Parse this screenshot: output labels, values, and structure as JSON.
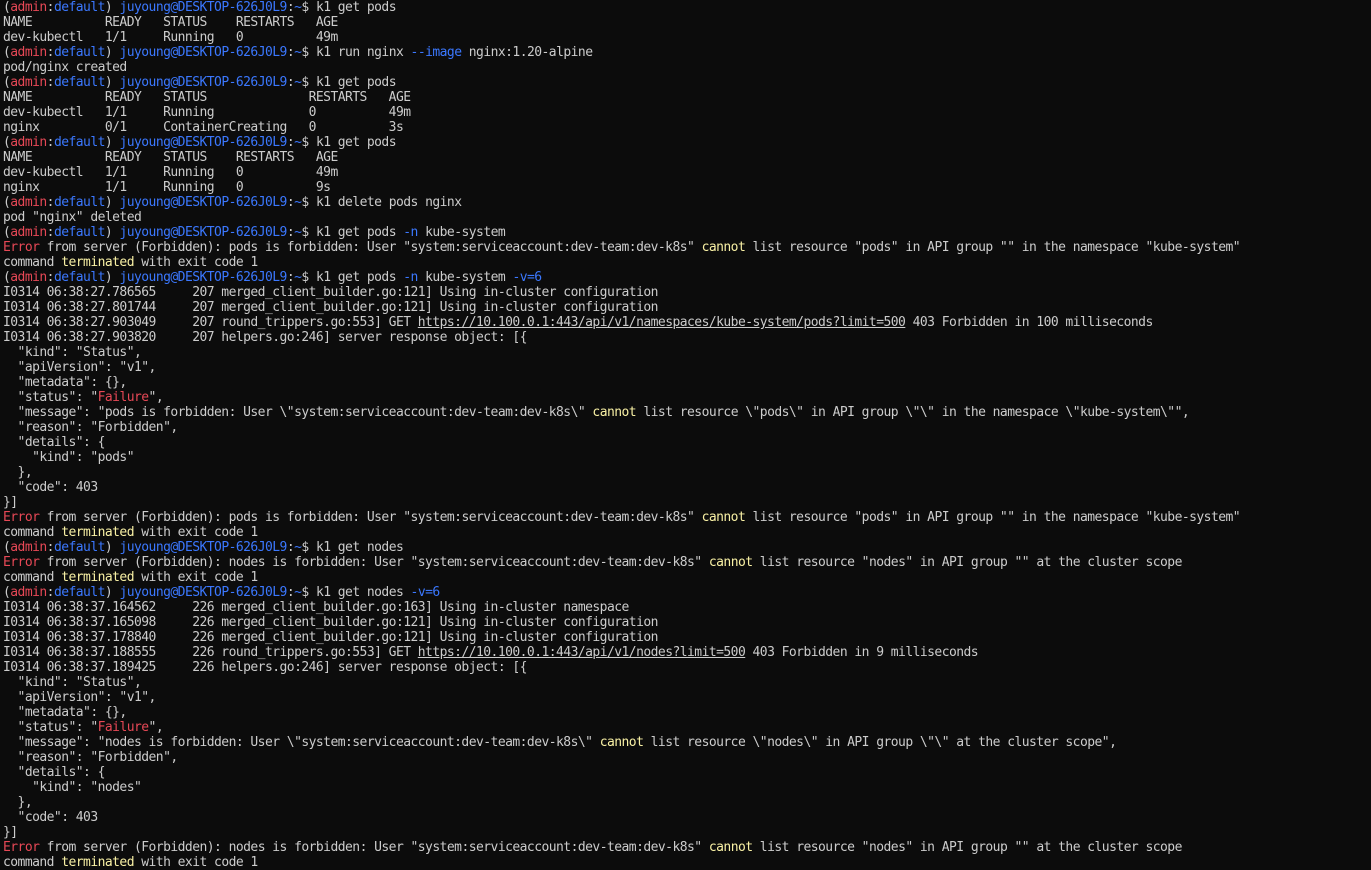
{
  "window": {
    "kind": "terminal",
    "background": "#0c0c0c",
    "colors": {
      "default": "#cccccc",
      "red": "#e74856",
      "blue": "#3b78ff",
      "yellow": "#f9f1a5"
    }
  },
  "prompt": {
    "open": "(",
    "user": "admin",
    "sep": ":",
    "ns": "default",
    "close": ")",
    "host": " juyoung@DESKTOP-626J0L9",
    "colon": ":",
    "path": "~",
    "dollar": "$ "
  },
  "lines": [
    [
      {
        "t": "(",
        "c": "plain",
        "p": true
      },
      {
        "t": "admin",
        "c": "red"
      },
      {
        "t": ":",
        "c": "plain"
      },
      {
        "t": "default",
        "c": "blue"
      },
      {
        "t": ") ",
        "c": "plain"
      },
      {
        "t": "juyoung@DESKTOP-626J0L9",
        "c": "blue"
      },
      {
        "t": ":",
        "c": "plain"
      },
      {
        "t": "~",
        "c": "blue"
      },
      {
        "t": "$ k1 get pods",
        "c": "plain"
      }
    ],
    [
      {
        "t": "NAME          READY   STATUS    RESTARTS   AGE",
        "c": "plain"
      }
    ],
    [
      {
        "t": "dev-kubectl   1/1     Running   0          49m",
        "c": "plain"
      }
    ],
    [
      {
        "t": "(",
        "c": "plain",
        "p": true
      },
      {
        "t": "admin",
        "c": "red"
      },
      {
        "t": ":",
        "c": "plain"
      },
      {
        "t": "default",
        "c": "blue"
      },
      {
        "t": ") ",
        "c": "plain"
      },
      {
        "t": "juyoung@DESKTOP-626J0L9",
        "c": "blue"
      },
      {
        "t": ":",
        "c": "plain"
      },
      {
        "t": "~",
        "c": "blue"
      },
      {
        "t": "$ k1 run nginx ",
        "c": "plain"
      },
      {
        "t": "--image",
        "c": "blue"
      },
      {
        "t": " nginx:1.20-alpine",
        "c": "plain"
      }
    ],
    [
      {
        "t": "pod/nginx created",
        "c": "plain"
      }
    ],
    [
      {
        "t": "(",
        "c": "plain",
        "p": true
      },
      {
        "t": "admin",
        "c": "red"
      },
      {
        "t": ":",
        "c": "plain"
      },
      {
        "t": "default",
        "c": "blue"
      },
      {
        "t": ") ",
        "c": "plain"
      },
      {
        "t": "juyoung@DESKTOP-626J0L9",
        "c": "blue"
      },
      {
        "t": ":",
        "c": "plain"
      },
      {
        "t": "~",
        "c": "blue"
      },
      {
        "t": "$ k1 get pods",
        "c": "plain"
      }
    ],
    [
      {
        "t": "NAME          READY   STATUS              RESTARTS   AGE",
        "c": "plain"
      }
    ],
    [
      {
        "t": "dev-kubectl   1/1     Running             0          49m",
        "c": "plain"
      }
    ],
    [
      {
        "t": "nginx         0/1     ContainerCreating   0          3s",
        "c": "plain"
      }
    ],
    [
      {
        "t": "(",
        "c": "plain",
        "p": true
      },
      {
        "t": "admin",
        "c": "red"
      },
      {
        "t": ":",
        "c": "plain"
      },
      {
        "t": "default",
        "c": "blue"
      },
      {
        "t": ") ",
        "c": "plain"
      },
      {
        "t": "juyoung@DESKTOP-626J0L9",
        "c": "blue"
      },
      {
        "t": ":",
        "c": "plain"
      },
      {
        "t": "~",
        "c": "blue"
      },
      {
        "t": "$ k1 get pods",
        "c": "plain"
      }
    ],
    [
      {
        "t": "NAME          READY   STATUS    RESTARTS   AGE",
        "c": "plain"
      }
    ],
    [
      {
        "t": "dev-kubectl   1/1     Running   0          49m",
        "c": "plain"
      }
    ],
    [
      {
        "t": "nginx         1/1     Running   0          9s",
        "c": "plain"
      }
    ],
    [
      {
        "t": "(",
        "c": "plain",
        "p": true
      },
      {
        "t": "admin",
        "c": "red"
      },
      {
        "t": ":",
        "c": "plain"
      },
      {
        "t": "default",
        "c": "blue"
      },
      {
        "t": ") ",
        "c": "plain"
      },
      {
        "t": "juyoung@DESKTOP-626J0L9",
        "c": "blue"
      },
      {
        "t": ":",
        "c": "plain"
      },
      {
        "t": "~",
        "c": "blue"
      },
      {
        "t": "$ k1 delete pods nginx",
        "c": "plain"
      }
    ],
    [
      {
        "t": "pod \"nginx\" deleted",
        "c": "plain"
      }
    ],
    [
      {
        "t": "(",
        "c": "plain",
        "p": true
      },
      {
        "t": "admin",
        "c": "red"
      },
      {
        "t": ":",
        "c": "plain"
      },
      {
        "t": "default",
        "c": "blue"
      },
      {
        "t": ") ",
        "c": "plain"
      },
      {
        "t": "juyoung@DESKTOP-626J0L9",
        "c": "blue"
      },
      {
        "t": ":",
        "c": "plain"
      },
      {
        "t": "~",
        "c": "blue"
      },
      {
        "t": "$ k1 get pods ",
        "c": "plain"
      },
      {
        "t": "-n",
        "c": "blue"
      },
      {
        "t": " kube-system",
        "c": "plain"
      }
    ],
    [
      {
        "t": "Error",
        "c": "red"
      },
      {
        "t": " from server (Forbidden): pods is forbidden: User \"system:serviceaccount:dev-team:dev-k8s\" ",
        "c": "plain"
      },
      {
        "t": "cannot",
        "c": "yellow"
      },
      {
        "t": " list resource \"pods\" in API group \"\" in the namespace \"kube-system\"",
        "c": "plain"
      }
    ],
    [
      {
        "t": "command ",
        "c": "plain"
      },
      {
        "t": "terminated",
        "c": "yellow"
      },
      {
        "t": " with exit code 1",
        "c": "plain"
      }
    ],
    [
      {
        "t": "(",
        "c": "plain",
        "p": true
      },
      {
        "t": "admin",
        "c": "red"
      },
      {
        "t": ":",
        "c": "plain"
      },
      {
        "t": "default",
        "c": "blue"
      },
      {
        "t": ") ",
        "c": "plain"
      },
      {
        "t": "juyoung@DESKTOP-626J0L9",
        "c": "blue"
      },
      {
        "t": ":",
        "c": "plain"
      },
      {
        "t": "~",
        "c": "blue"
      },
      {
        "t": "$ k1 get pods ",
        "c": "plain"
      },
      {
        "t": "-n",
        "c": "blue"
      },
      {
        "t": " kube-system ",
        "c": "plain"
      },
      {
        "t": "-v=6",
        "c": "blue"
      }
    ],
    [
      {
        "t": "I0314 06:38:27.786565     207 merged_client_builder.go:121] Using in-cluster configuration",
        "c": "plain"
      }
    ],
    [
      {
        "t": "I0314 06:38:27.801744     207 merged_client_builder.go:121] Using in-cluster configuration",
        "c": "plain"
      }
    ],
    [
      {
        "t": "I0314 06:38:27.903049     207 round_trippers.go:553] GET ",
        "c": "plain"
      },
      {
        "t": "https://10.100.0.1:443/api/v1/namespaces/kube-system/pods?limit=500",
        "c": "under"
      },
      {
        "t": " 403 Forbidden in 100 milliseconds",
        "c": "plain"
      }
    ],
    [
      {
        "t": "I0314 06:38:27.903820     207 helpers.go:246] server response object: [{",
        "c": "plain"
      }
    ],
    [
      {
        "t": "  \"kind\": \"Status\",",
        "c": "plain"
      }
    ],
    [
      {
        "t": "  \"apiVersion\": \"v1\",",
        "c": "plain"
      }
    ],
    [
      {
        "t": "  \"metadata\": {},",
        "c": "plain"
      }
    ],
    [
      {
        "t": "  \"status\": \"",
        "c": "plain"
      },
      {
        "t": "Failure",
        "c": "red"
      },
      {
        "t": "\",",
        "c": "plain"
      }
    ],
    [
      {
        "t": "  \"message\": \"pods is forbidden: User \\\"system:serviceaccount:dev-team:dev-k8s\\\" ",
        "c": "plain"
      },
      {
        "t": "cannot",
        "c": "yellow"
      },
      {
        "t": " list resource \\\"pods\\\" in API group \\\"\\\" in the namespace \\\"kube-system\\\"\",",
        "c": "plain"
      }
    ],
    [
      {
        "t": "  \"reason\": \"Forbidden\",",
        "c": "plain"
      }
    ],
    [
      {
        "t": "  \"details\": {",
        "c": "plain"
      }
    ],
    [
      {
        "t": "    \"kind\": \"pods\"",
        "c": "plain"
      }
    ],
    [
      {
        "t": "  },",
        "c": "plain"
      }
    ],
    [
      {
        "t": "  \"code\": 403",
        "c": "plain"
      }
    ],
    [
      {
        "t": "}]",
        "c": "plain"
      }
    ],
    [
      {
        "t": "Error",
        "c": "red"
      },
      {
        "t": " from server (Forbidden): pods is forbidden: User \"system:serviceaccount:dev-team:dev-k8s\" ",
        "c": "plain"
      },
      {
        "t": "cannot",
        "c": "yellow"
      },
      {
        "t": " list resource \"pods\" in API group \"\" in the namespace \"kube-system\"",
        "c": "plain"
      }
    ],
    [
      {
        "t": "command ",
        "c": "plain"
      },
      {
        "t": "terminated",
        "c": "yellow"
      },
      {
        "t": " with exit code 1",
        "c": "plain"
      }
    ],
    [
      {
        "t": "(",
        "c": "plain",
        "p": true
      },
      {
        "t": "admin",
        "c": "red"
      },
      {
        "t": ":",
        "c": "plain"
      },
      {
        "t": "default",
        "c": "blue"
      },
      {
        "t": ") ",
        "c": "plain"
      },
      {
        "t": "juyoung@DESKTOP-626J0L9",
        "c": "blue"
      },
      {
        "t": ":",
        "c": "plain"
      },
      {
        "t": "~",
        "c": "blue"
      },
      {
        "t": "$ k1 get nodes",
        "c": "plain"
      }
    ],
    [
      {
        "t": "Error",
        "c": "red"
      },
      {
        "t": " from server (Forbidden): nodes is forbidden: User \"system:serviceaccount:dev-team:dev-k8s\" ",
        "c": "plain"
      },
      {
        "t": "cannot",
        "c": "yellow"
      },
      {
        "t": " list resource \"nodes\" in API group \"\" at the cluster scope",
        "c": "plain"
      }
    ],
    [
      {
        "t": "command ",
        "c": "plain"
      },
      {
        "t": "terminated",
        "c": "yellow"
      },
      {
        "t": " with exit code 1",
        "c": "plain"
      }
    ],
    [
      {
        "t": "(",
        "c": "plain",
        "p": true
      },
      {
        "t": "admin",
        "c": "red"
      },
      {
        "t": ":",
        "c": "plain"
      },
      {
        "t": "default",
        "c": "blue"
      },
      {
        "t": ") ",
        "c": "plain"
      },
      {
        "t": "juyoung@DESKTOP-626J0L9",
        "c": "blue"
      },
      {
        "t": ":",
        "c": "plain"
      },
      {
        "t": "~",
        "c": "blue"
      },
      {
        "t": "$ k1 get nodes ",
        "c": "plain"
      },
      {
        "t": "-v=6",
        "c": "blue"
      }
    ],
    [
      {
        "t": "I0314 06:38:37.164562     226 merged_client_builder.go:163] Using in-cluster namespace",
        "c": "plain"
      }
    ],
    [
      {
        "t": "I0314 06:38:37.165098     226 merged_client_builder.go:121] Using in-cluster configuration",
        "c": "plain"
      }
    ],
    [
      {
        "t": "I0314 06:38:37.178840     226 merged_client_builder.go:121] Using in-cluster configuration",
        "c": "plain"
      }
    ],
    [
      {
        "t": "I0314 06:38:37.188555     226 round_trippers.go:553] GET ",
        "c": "plain"
      },
      {
        "t": "https://10.100.0.1:443/api/v1/nodes?limit=500",
        "c": "under"
      },
      {
        "t": " 403 Forbidden in 9 milliseconds",
        "c": "plain"
      }
    ],
    [
      {
        "t": "I0314 06:38:37.189425     226 helpers.go:246] server response object: [{",
        "c": "plain"
      }
    ],
    [
      {
        "t": "  \"kind\": \"Status\",",
        "c": "plain"
      }
    ],
    [
      {
        "t": "  \"apiVersion\": \"v1\",",
        "c": "plain"
      }
    ],
    [
      {
        "t": "  \"metadata\": {},",
        "c": "plain"
      }
    ],
    [
      {
        "t": "  \"status\": \"",
        "c": "plain"
      },
      {
        "t": "Failure",
        "c": "red"
      },
      {
        "t": "\",",
        "c": "plain"
      }
    ],
    [
      {
        "t": "  \"message\": \"nodes is forbidden: User \\\"system:serviceaccount:dev-team:dev-k8s\\\" ",
        "c": "plain"
      },
      {
        "t": "cannot",
        "c": "yellow"
      },
      {
        "t": " list resource \\\"nodes\\\" in API group \\\"\\\" at the cluster scope\",",
        "c": "plain"
      }
    ],
    [
      {
        "t": "  \"reason\": \"Forbidden\",",
        "c": "plain"
      }
    ],
    [
      {
        "t": "  \"details\": {",
        "c": "plain"
      }
    ],
    [
      {
        "t": "    \"kind\": \"nodes\"",
        "c": "plain"
      }
    ],
    [
      {
        "t": "  },",
        "c": "plain"
      }
    ],
    [
      {
        "t": "  \"code\": 403",
        "c": "plain"
      }
    ],
    [
      {
        "t": "}]",
        "c": "plain"
      }
    ],
    [
      {
        "t": "Error",
        "c": "red"
      },
      {
        "t": " from server (Forbidden): nodes is forbidden: User \"system:serviceaccount:dev-team:dev-k8s\" ",
        "c": "plain"
      },
      {
        "t": "cannot",
        "c": "yellow"
      },
      {
        "t": " list resource \"nodes\" in API group \"\" at the cluster scope",
        "c": "plain"
      }
    ],
    [
      {
        "t": "command ",
        "c": "plain"
      },
      {
        "t": "terminated",
        "c": "yellow"
      },
      {
        "t": " with exit code 1",
        "c": "plain"
      }
    ]
  ]
}
